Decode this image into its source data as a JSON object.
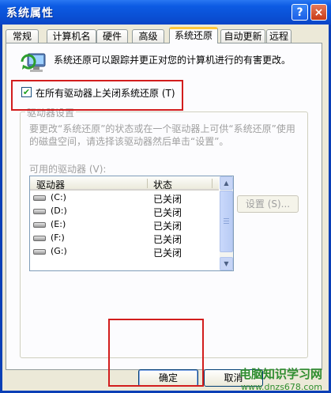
{
  "window": {
    "title": "系统属性",
    "help_label": "?",
    "close_label": "×"
  },
  "tabs": [
    {
      "label": "常规",
      "selected": false
    },
    {
      "label": "计算机名",
      "selected": false
    },
    {
      "label": "硬件",
      "selected": false
    },
    {
      "label": "高级",
      "selected": false
    },
    {
      "label": "系统还原",
      "selected": true
    },
    {
      "label": "自动更新",
      "selected": false
    },
    {
      "label": "远程",
      "selected": false
    }
  ],
  "panel": {
    "intro": "系统还原可以跟踪并更正对您的计算机进行的有害更改。",
    "turn_off_label": "在所有驱动器上关闭系统还原 (T)",
    "turn_off_checked": true,
    "group_title": "驱动器设置",
    "description": "要更改“系统还原”的状态或在一个驱动器上可供“系统还原”使用的磁盘空间，请选择该驱动器然后单击“设置”。",
    "drives_label": "可用的驱动器 (V):",
    "columns": {
      "drive": "驱动器",
      "status": "状态"
    },
    "drives": [
      {
        "name": "(C:)",
        "status": "已关闭"
      },
      {
        "name": "(D:)",
        "status": "已关闭"
      },
      {
        "name": "(E:)",
        "status": "已关闭"
      },
      {
        "name": "(F:)",
        "status": "已关闭"
      },
      {
        "name": "(G:)",
        "status": "已关闭"
      }
    ],
    "settings_button": "设置 (S)..."
  },
  "buttons": {
    "ok": "确定",
    "cancel": "取消"
  },
  "watermark": {
    "title": "电脑知识学习网",
    "url": "www.dnzs678.com"
  },
  "colors": {
    "highlight_red": "#d21d1d",
    "title_blue": "#0a4fd4",
    "watermark_green": "#2f8d2f"
  }
}
